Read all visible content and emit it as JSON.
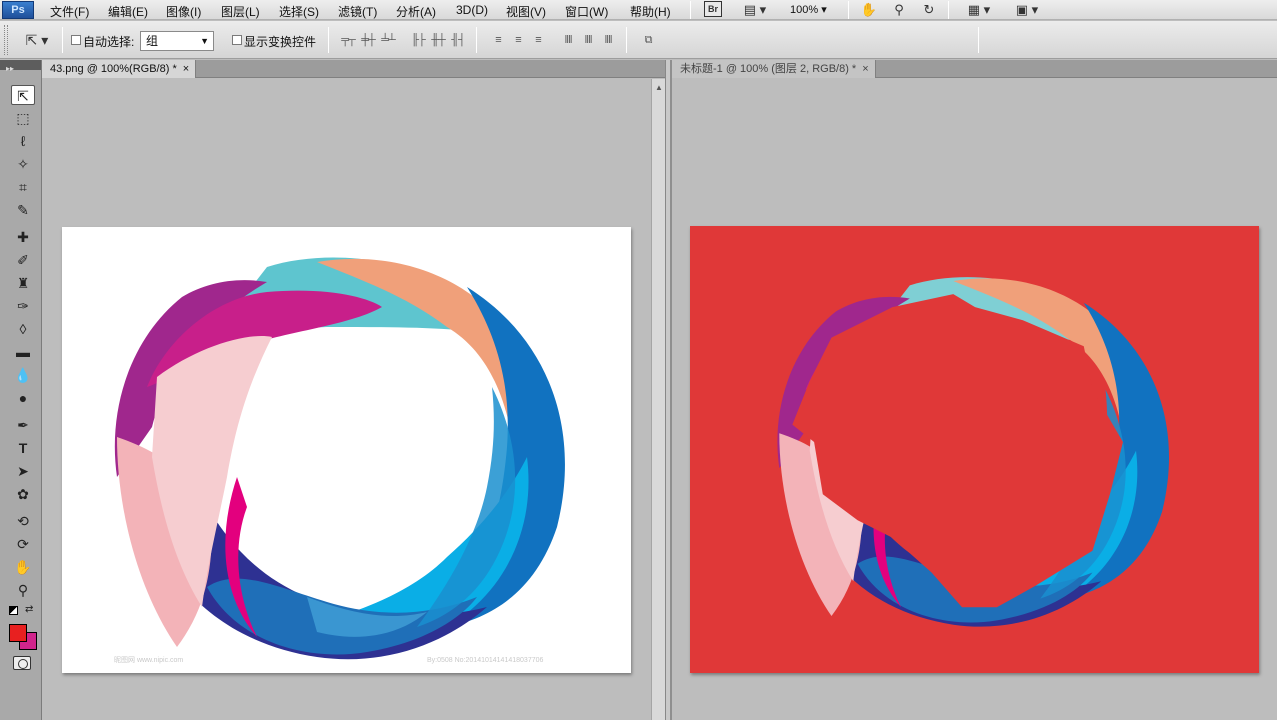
{
  "app": {
    "logo": "Ps"
  },
  "menu": {
    "items": [
      "文件(F)",
      "编辑(E)",
      "图像(I)",
      "图层(L)",
      "选择(S)",
      "滤镜(T)",
      "分析(A)",
      "3D(D)",
      "视图(V)",
      "窗口(W)",
      "帮助(H)"
    ],
    "bridge_label": "Br",
    "zoom": "100%",
    "icons": [
      "bridge-icon",
      "screen-mode-icon",
      "hand-icon",
      "zoom-icon",
      "rotate-view-icon",
      "arrange-documents-icon",
      "screen-size-icon"
    ]
  },
  "options": {
    "auto_select_label": "自动选择:",
    "auto_select_value": "组",
    "show_transform_label": "显示变换控件",
    "align_icons": [
      "align-top-icon",
      "align-vcenter-icon",
      "align-bottom-icon",
      "align-left-icon",
      "align-hcenter-icon",
      "align-right-icon"
    ],
    "distribute_icons": [
      "distribute-top-icon",
      "distribute-vcenter-icon",
      "distribute-bottom-icon",
      "distribute-left-icon",
      "distribute-hcenter-icon",
      "distribute-right-icon"
    ],
    "auto_align_icon": "auto-align-icon"
  },
  "tools": [
    "move-tool-icon",
    "marquee-tool-icon",
    "lasso-tool-icon",
    "magic-wand-icon",
    "crop-tool-icon",
    "eyedropper-icon",
    "healing-brush-icon",
    "brush-tool-icon",
    "clone-stamp-icon",
    "history-brush-icon",
    "eraser-icon",
    "gradient-icon",
    "blur-icon",
    "dodge-icon",
    "pen-tool-icon",
    "type-tool-icon",
    "path-selection-icon",
    "custom-shape-icon",
    "3d-rotate-icon",
    "3d-orbit-icon",
    "hand-tool-icon",
    "zoom-tool-icon"
  ],
  "colors": {
    "foreground": "#e82020",
    "background": "#d0258c",
    "right_canvas_bg": "#e03838"
  },
  "documents": [
    {
      "tab_label": "43.png @ 100%(RGB/8) *",
      "close": "×"
    },
    {
      "tab_label": "未标题-1 @ 100% (图层 2, RGB/8) *",
      "close": "×"
    }
  ],
  "watermarks": {
    "left": "昵图网 www.nipic.com",
    "right": "By:0508 No:20141014141418037706"
  }
}
